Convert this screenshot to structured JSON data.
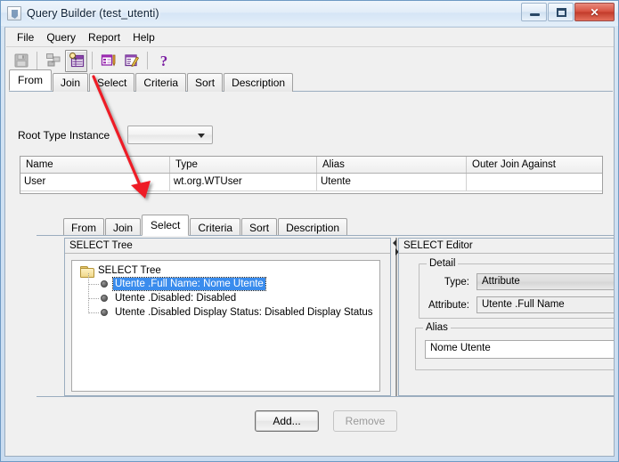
{
  "window": {
    "title": "Query Builder (test_utenti)",
    "icon": "java-app-icon",
    "controls": {
      "minimize": "minimize-button",
      "maximize": "maximize-button",
      "close_label": "✕"
    }
  },
  "menubar": {
    "items": [
      {
        "label": "File"
      },
      {
        "label": "Query"
      },
      {
        "label": "Report"
      },
      {
        "label": "Help"
      }
    ]
  },
  "toolbar": {
    "buttons": [
      {
        "name": "save-icon",
        "title": "Save",
        "enabled": false
      },
      {
        "name": "join-diagram-icon",
        "title": "Join Diagram",
        "enabled": false
      },
      {
        "name": "query-table-icon",
        "title": "Query Table",
        "enabled": true,
        "pressed": true
      },
      {
        "name": "report-table-icon",
        "title": "Report Table",
        "enabled": true
      },
      {
        "name": "edit-report-icon",
        "title": "Edit Report",
        "enabled": true
      },
      {
        "name": "help-question-icon",
        "title": "Help",
        "enabled": true
      }
    ]
  },
  "outer_tabs": {
    "items": [
      "From",
      "Join",
      "Select",
      "Criteria",
      "Sort",
      "Description"
    ],
    "active": "From"
  },
  "from_panel": {
    "root_type_label": "Root Type Instance",
    "root_type_value": "",
    "table": {
      "columns": [
        "Name",
        "Type",
        "Alias",
        "Outer Join Against"
      ],
      "rows": [
        [
          "User",
          "wt.org.WTUser",
          "Utente",
          ""
        ]
      ]
    }
  },
  "inner_dialog": {
    "tabs": {
      "items": [
        "From",
        "Join",
        "Select",
        "Criteria",
        "Sort",
        "Description"
      ],
      "active": "Select"
    },
    "tree_panel": {
      "title": "SELECT Tree",
      "root_label": "SELECT Tree",
      "nodes": [
        {
          "label": "Utente .Full Name:  Nome Utente",
          "selected": true
        },
        {
          "label": "Utente .Disabled: Disabled",
          "selected": false
        },
        {
          "label": "Utente .Disabled Display Status: Disabled Display Status",
          "selected": false
        }
      ]
    },
    "editor_panel": {
      "title": "SELECT Editor",
      "detail_legend": "Detail",
      "type_label": "Type:",
      "type_value": "Attribute",
      "attribute_label": "Attribute:",
      "attribute_value": "Utente .Full Name",
      "alias_legend": "Alias",
      "alias_value": "Nome Utente"
    },
    "buttons": {
      "add": "Add...",
      "remove": "Remove"
    }
  },
  "annotation": {
    "arrow_color": "#ee1c25",
    "points_from": "Select tab (outer)",
    "points_to": "Select tab (inner dialog)"
  },
  "colors": {
    "accent_selection": "#3a8ced",
    "frame": "#b8d3ea",
    "panel_bg": "#f0f0f0",
    "close_button": "#d6503f"
  }
}
